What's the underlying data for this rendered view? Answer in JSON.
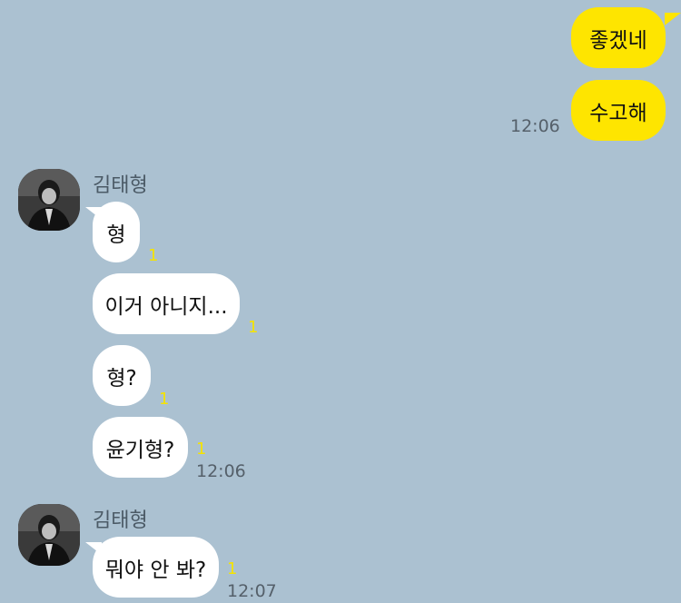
{
  "conversation": {
    "outgoing": [
      {
        "text": "좋겠네"
      },
      {
        "text": "수고해",
        "time": "12:06"
      }
    ],
    "groups": [
      {
        "sender": "김태형",
        "messages": [
          {
            "text": "형",
            "unread": "1"
          },
          {
            "text": "이거 아니지...",
            "unread": "1"
          },
          {
            "text": "형?",
            "unread": "1"
          },
          {
            "text": "윤기형?",
            "unread": "1",
            "time": "12:06"
          }
        ]
      },
      {
        "sender": "김태형",
        "messages": [
          {
            "text": "뭐야 안 봐?",
            "unread": "1",
            "time": "12:07"
          }
        ]
      }
    ]
  },
  "colors": {
    "background": "#abc1d1",
    "outgoing_bubble": "#fee500",
    "incoming_bubble": "#ffffff",
    "unread_count": "#f5e300"
  }
}
